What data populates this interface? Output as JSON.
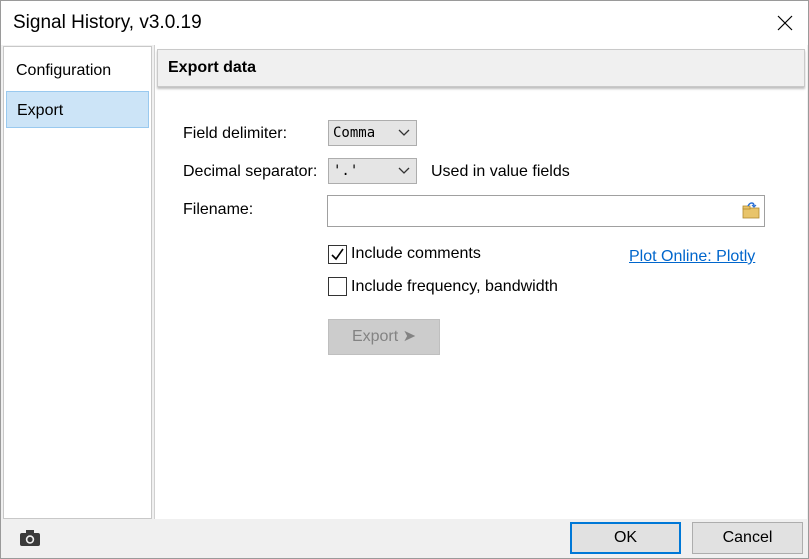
{
  "window": {
    "title": "Signal History, v3.0.19"
  },
  "sidebar": {
    "items": [
      {
        "label": "Configuration",
        "selected": false
      },
      {
        "label": "Export",
        "selected": true
      }
    ]
  },
  "panel": {
    "header": "Export data",
    "field_delimiter": {
      "label": "Field delimiter:",
      "value": "Comma"
    },
    "decimal_separator": {
      "label": "Decimal separator:",
      "value": "'.'",
      "hint": "Used in value fields"
    },
    "filename": {
      "label": "Filename:",
      "value": ""
    },
    "include_comments": {
      "label": "Include comments",
      "checked": true
    },
    "include_frequency": {
      "label": "Include frequency, bandwidth",
      "checked": false
    },
    "plot_link": "Plot Online: Plotly",
    "export_button": "Export ➤"
  },
  "footer": {
    "ok_label": "OK",
    "cancel_label": "Cancel"
  },
  "colors": {
    "selection": "#cce4f7",
    "link": "#0066cc",
    "primary_border": "#0078d7"
  },
  "icons": {
    "close": "close-icon",
    "chevron": "chevron-down-icon",
    "browse": "folder-browse-icon",
    "camera": "camera-icon",
    "check": "checkmark-icon"
  }
}
